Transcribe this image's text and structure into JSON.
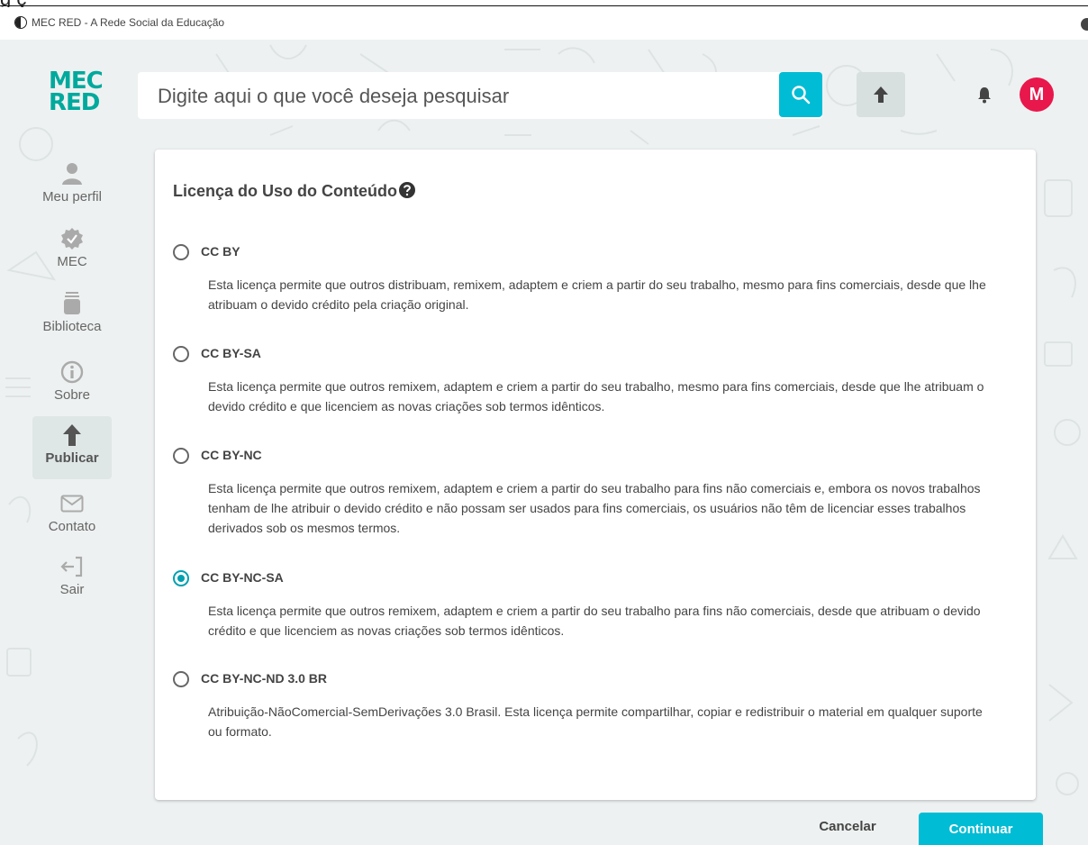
{
  "browser": {
    "cut_title": "g          ç",
    "tab_title": "MEC RED - A Rede Social da Educação"
  },
  "header": {
    "logo_line1": "MEC",
    "logo_line2": "RED",
    "search_placeholder": "Digite aqui o que você deseja pesquisar",
    "avatar_letter": "M"
  },
  "sidebar": {
    "items": [
      {
        "label": "Meu perfil",
        "icon": "user-icon"
      },
      {
        "label": "MEC",
        "icon": "verified-check-icon"
      },
      {
        "label": "Biblioteca",
        "icon": "library-icon"
      },
      {
        "label": "Sobre",
        "icon": "info-icon"
      },
      {
        "label": "Publicar",
        "icon": "upload-arrow-icon",
        "active": true
      },
      {
        "label": "Contato",
        "icon": "mail-icon"
      },
      {
        "label": "Sair",
        "icon": "logout-icon"
      }
    ]
  },
  "license": {
    "title": "Licença do Uso do Conteúdo",
    "options": [
      {
        "name": "CC BY",
        "checked": false,
        "description": "Esta licença permite que outros distribuam, remixem, adaptem e criem a partir do seu trabalho, mesmo para fins comerciais, desde que lhe atribuam o devido crédito pela criação original."
      },
      {
        "name": "CC BY-SA",
        "checked": false,
        "description": "Esta licença permite que outros remixem, adaptem e criem a partir do seu trabalho, mesmo para fins comerciais, desde que lhe atribuam o devido crédito e que licenciem as novas criações sob termos idênticos."
      },
      {
        "name": "CC BY-NC",
        "checked": false,
        "description": "Esta licença permite que outros remixem, adaptem e criem a partir do seu trabalho para fins não comerciais e, embora os novos trabalhos tenham de lhe atribuir o devido crédito e não possam ser usados para fins comerciais, os usuários não têm de licenciar esses trabalhos derivados sob os mesmos termos."
      },
      {
        "name": "CC BY-NC-SA",
        "checked": true,
        "description": "Esta licença permite que outros remixem, adaptem e criem a partir do seu trabalho para fins não comerciais, desde que atribuam o devido crédito e que licenciem as novas criações sob termos idênticos."
      },
      {
        "name": "CC BY-NC-ND 3.0 BR",
        "checked": false,
        "description": "Atribuição-NãoComercial-SemDerivações 3.0 Brasil. Esta licença permite compartilhar, copiar e redistribuir o material em qualquer suporte ou formato."
      }
    ]
  },
  "footer": {
    "cancel_label": "Cancelar",
    "continue_label": "Continuar"
  },
  "colors": {
    "accent": "#00bcd4",
    "radio_checked": "#00a0b0",
    "avatar": "#e8174c",
    "logo_teal": "#00a99d",
    "logo_purple": "#5b2c8e"
  }
}
